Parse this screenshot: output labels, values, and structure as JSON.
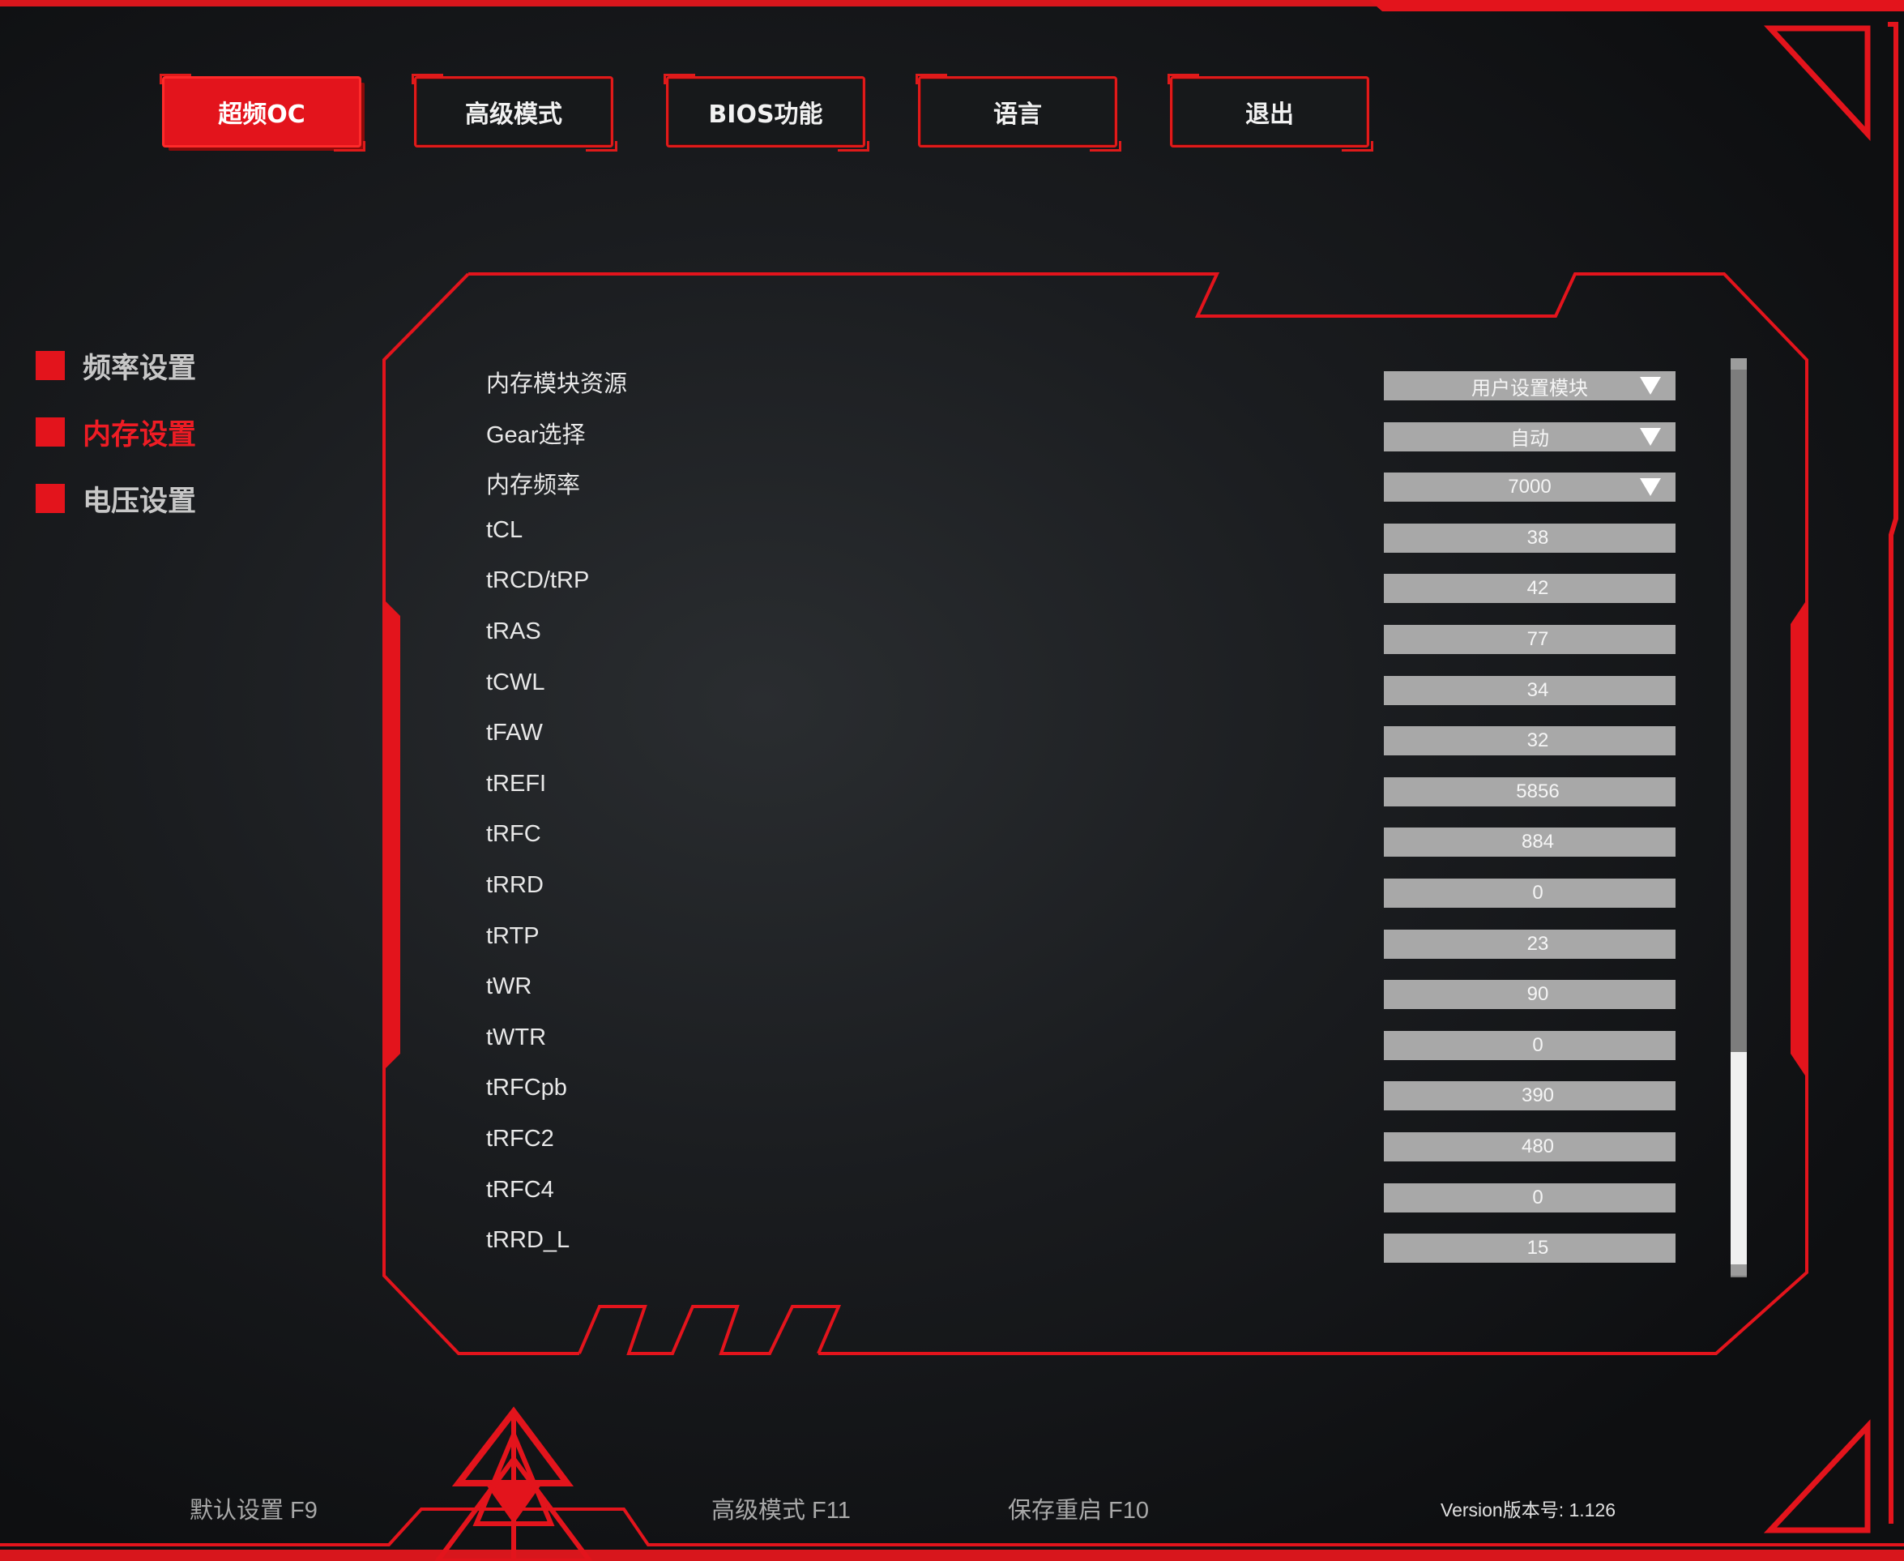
{
  "tabs": [
    {
      "label": "超频OC",
      "active": true
    },
    {
      "label": "高级模式",
      "active": false
    },
    {
      "label": "BIOS功能",
      "active": false
    },
    {
      "label": "语言",
      "active": false
    },
    {
      "label": "退出",
      "active": false
    }
  ],
  "sidebar": {
    "items": [
      {
        "label": "频率设置",
        "active": false
      },
      {
        "label": "内存设置",
        "active": true
      },
      {
        "label": "电压设置",
        "active": false
      }
    ]
  },
  "settings": [
    {
      "label": "内存模块资源",
      "value": "用户设置模块",
      "type": "dropdown"
    },
    {
      "label": "Gear选择",
      "value": "自动",
      "type": "dropdown"
    },
    {
      "label": "内存频率",
      "value": "7000",
      "type": "dropdown"
    },
    {
      "label": "tCL",
      "value": "38",
      "type": "number"
    },
    {
      "label": "tRCD/tRP",
      "value": "42",
      "type": "number"
    },
    {
      "label": "tRAS",
      "value": "77",
      "type": "number"
    },
    {
      "label": "tCWL",
      "value": "34",
      "type": "number"
    },
    {
      "label": "tFAW",
      "value": "32",
      "type": "number"
    },
    {
      "label": "tREFI",
      "value": "5856",
      "type": "number"
    },
    {
      "label": "tRFC",
      "value": "884",
      "type": "number"
    },
    {
      "label": "tRRD",
      "value": "0",
      "type": "number"
    },
    {
      "label": "tRTP",
      "value": "23",
      "type": "number"
    },
    {
      "label": "tWR",
      "value": "90",
      "type": "number"
    },
    {
      "label": "tWTR",
      "value": "0",
      "type": "number"
    },
    {
      "label": "tRFCpb",
      "value": "390",
      "type": "number"
    },
    {
      "label": "tRFC2",
      "value": "480",
      "type": "number"
    },
    {
      "label": "tRFC4",
      "value": "0",
      "type": "number"
    },
    {
      "label": "tRRD_L",
      "value": "15",
      "type": "number"
    }
  ],
  "footer": {
    "default_label": "默认设置 F9",
    "advanced_label": "高级模式 F11",
    "save_label": "保存重启 F10",
    "version": "Version版本号: 1.126"
  },
  "colors": {
    "accent": "#e3141c",
    "background": "#1a1c1f",
    "field": "#a8a8a8"
  },
  "icons": {
    "dropdown": "triangle-down-icon",
    "logo": "triangle-emblem-logo"
  }
}
